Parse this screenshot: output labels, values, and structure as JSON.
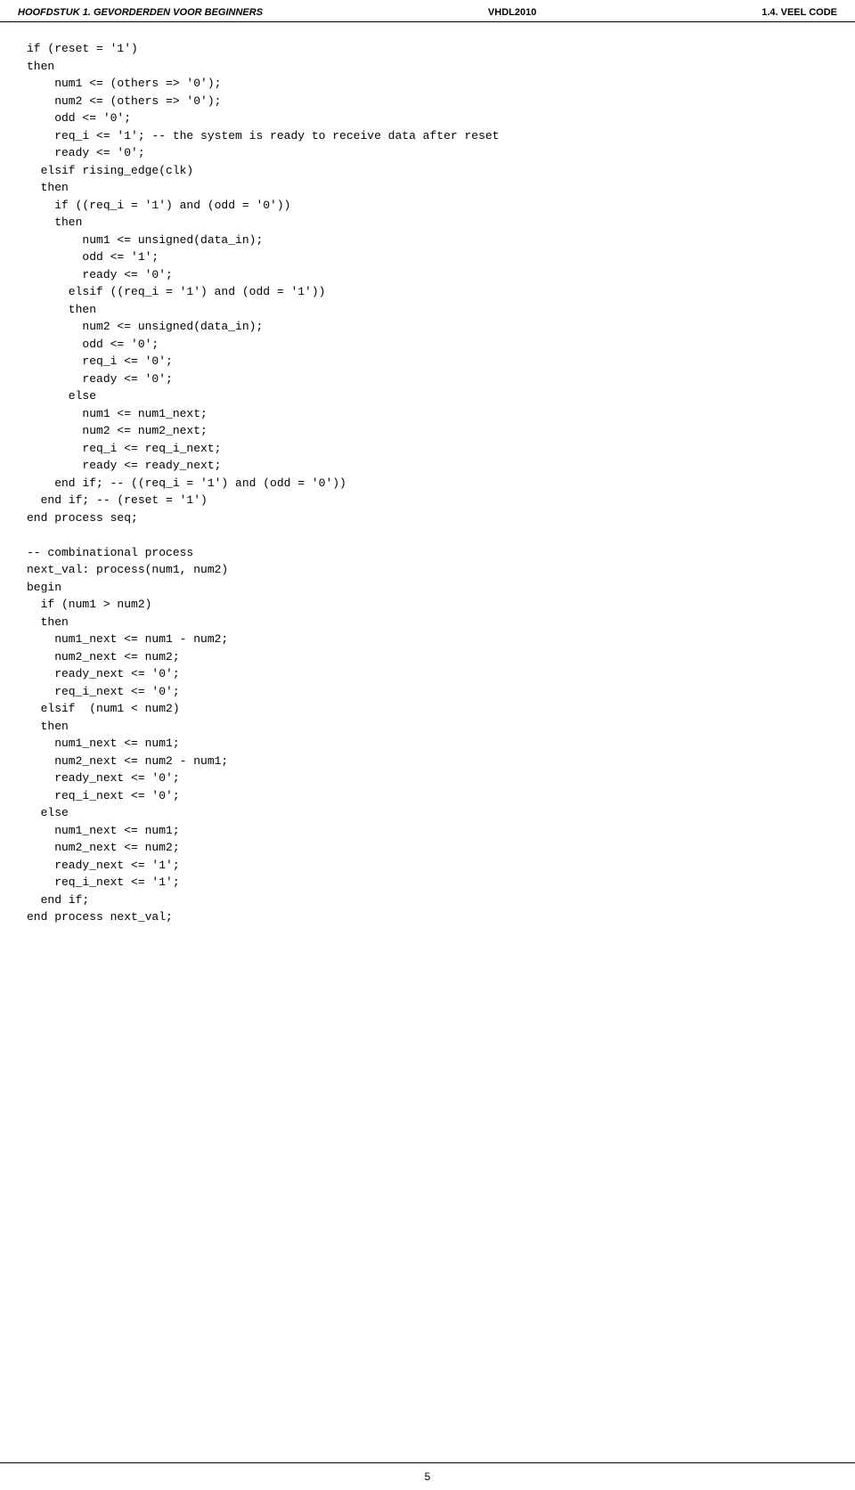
{
  "header": {
    "left": "HOOFDSTUK 1.  GEVORDERDEN VOOR BEGINNERS",
    "center": "VHDL2010",
    "right": "1.4.  VEEL CODE"
  },
  "footer": {
    "page_number": "5"
  },
  "code": {
    "content": "if (reset = '1')\nthen\n    num1 <= (others => '0');\n    num2 <= (others => '0');\n    odd <= '0';\n    req_i <= '1'; -- the system is ready to receive data after reset\n    ready <= '0';\n  elsif rising_edge(clk)\n  then\n    if ((req_i = '1') and (odd = '0'))\n    then\n        num1 <= unsigned(data_in);\n        odd <= '1';\n        ready <= '0';\n      elsif ((req_i = '1') and (odd = '1'))\n      then\n        num2 <= unsigned(data_in);\n        odd <= '0';\n        req_i <= '0';\n        ready <= '0';\n      else\n        num1 <= num1_next;\n        num2 <= num2_next;\n        req_i <= req_i_next;\n        ready <= ready_next;\n    end if; -- ((req_i = '1') and (odd = '0'))\n  end if; -- (reset = '1')\nend process seq;\n\n-- combinational process\nnext_val: process(num1, num2)\nbegin\n  if (num1 > num2)\n  then\n    num1_next <= num1 - num2;\n    num2_next <= num2;\n    ready_next <= '0';\n    req_i_next <= '0';\n  elsif  (num1 < num2)\n  then\n    num1_next <= num1;\n    num2_next <= num2 - num1;\n    ready_next <= '0';\n    req_i_next <= '0';\n  else\n    num1_next <= num1;\n    num2_next <= num2;\n    ready_next <= '1';\n    req_i_next <= '1';\n  end if;\nend process next_val;"
  }
}
